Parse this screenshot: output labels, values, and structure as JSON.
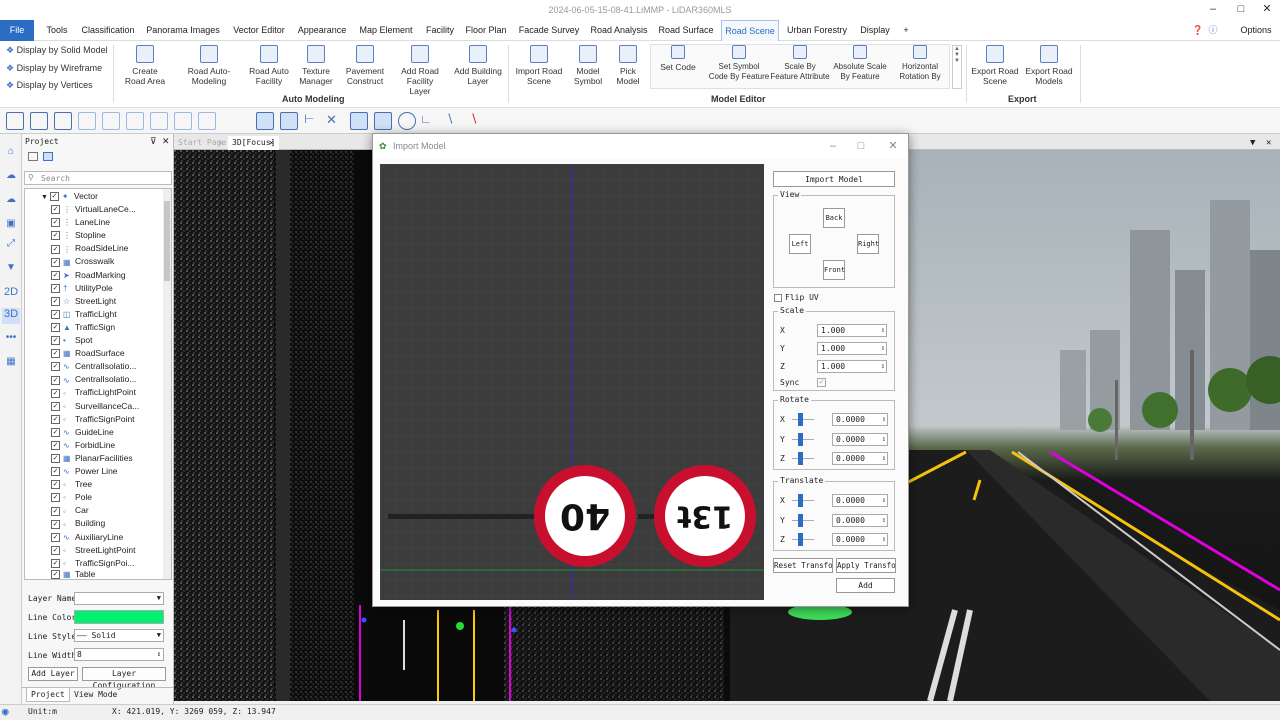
{
  "window": {
    "title": "2024-06-05-15-08-41.LiMMP - LiDAR360MLS"
  },
  "menu": {
    "items": [
      "File",
      "Tools",
      "Classification",
      "Panorama Images",
      "Vector Editor",
      "Appearance",
      "Map Element",
      "Facility",
      "Floor Plan",
      "Facade Survey",
      "Road Analysis",
      "Road Surface",
      "Road Scene",
      "Urban Forestry",
      "Display",
      "+"
    ],
    "active": "Road Scene",
    "options": "Options"
  },
  "ribbon": {
    "display": [
      "Display by Solid Model",
      "Display by Wireframe",
      "Display by Vertices"
    ],
    "auto_modeling": {
      "group": "Auto Modeling",
      "buttons": [
        "Create Road Area",
        "Road Auto-Modeling",
        "Road Auto Facility",
        "Texture Manager",
        "Pavement Construct",
        "Add Road Facility Layer",
        "Add Building Layer"
      ]
    },
    "model_editor": {
      "group": "Model Editor",
      "buttons": [
        "Import Road Scene",
        "Model Symbol",
        "Pick Model"
      ],
      "small": [
        "Set Code",
        "Set Symbol Code By Feature",
        "Scale By Feature Attribute",
        "Absolute Scale By Feature",
        "Horizontal Rotation By"
      ]
    },
    "export": {
      "group": "Export",
      "buttons": [
        "Export Road Scene",
        "Export Road Models"
      ]
    }
  },
  "project": {
    "title": "Project",
    "search_placeholder": "Search",
    "root": "Vector",
    "layers": [
      "VirtualLaneCe...",
      "LaneLine",
      "Stopline",
      "RoadSideLine",
      "Crosswalk",
      "RoadMarking",
      "UtilityPole",
      "StreetLight",
      "TrafficLight",
      "TrafficSign",
      "Spot",
      "RoadSurface",
      "CentralIsolatio...",
      "CentralIsolatio...",
      "TrafficLightPoint",
      "SurveillanceCa...",
      "TrafficSignPoint",
      "GuideLine",
      "ForbidLine",
      "PlanarFacilities",
      "Power Line",
      "Tree",
      "Pole",
      "Car",
      "Building",
      "AuxiliaryLine",
      "StreetLightPoint",
      "TrafficSignPoi..."
    ],
    "table": "Table",
    "props": {
      "layer_name_label": "Layer Name",
      "line_color_label": "Line Color",
      "line_color": "#00f070",
      "line_style_label": "Line Style",
      "line_style": "Solid",
      "line_width_label": "Line Width",
      "line_width": "8"
    },
    "add_layer": "Add Layer",
    "layer_config": "Layer Configuration",
    "tabs": [
      "Project",
      "View Mode"
    ]
  },
  "view_tabs": [
    "Start Page",
    "3D[Focus]"
  ],
  "status": {
    "unit": "Unit:m",
    "coords": "X: 421.019, Y: 3269 059, Z: 13.947"
  },
  "dialog": {
    "title": "Import Model",
    "import_button": "Import Model",
    "view": {
      "label": "View",
      "back": "Back",
      "left": "Left",
      "right": "Right",
      "front": "Front"
    },
    "flip_uv": "Flip UV",
    "scale": {
      "label": "Scale",
      "x": "1.000",
      "y": "1.000",
      "z": "1.000",
      "sync": "Sync"
    },
    "rotate": {
      "label": "Rotate",
      "x": "0.0000",
      "y": "0.0000",
      "z": "0.0000"
    },
    "translate": {
      "label": "Translate",
      "x": "0.0000",
      "y": "0.0000",
      "z": "0.0000"
    },
    "reset": "Reset Transform",
    "apply": "Apply Transform",
    "add": "Add",
    "signs": [
      "40",
      "13t"
    ]
  },
  "colors": {
    "accent": "#2b6cc4",
    "sign_red": "#c8102e",
    "grid_line": "#1f8f3a"
  }
}
